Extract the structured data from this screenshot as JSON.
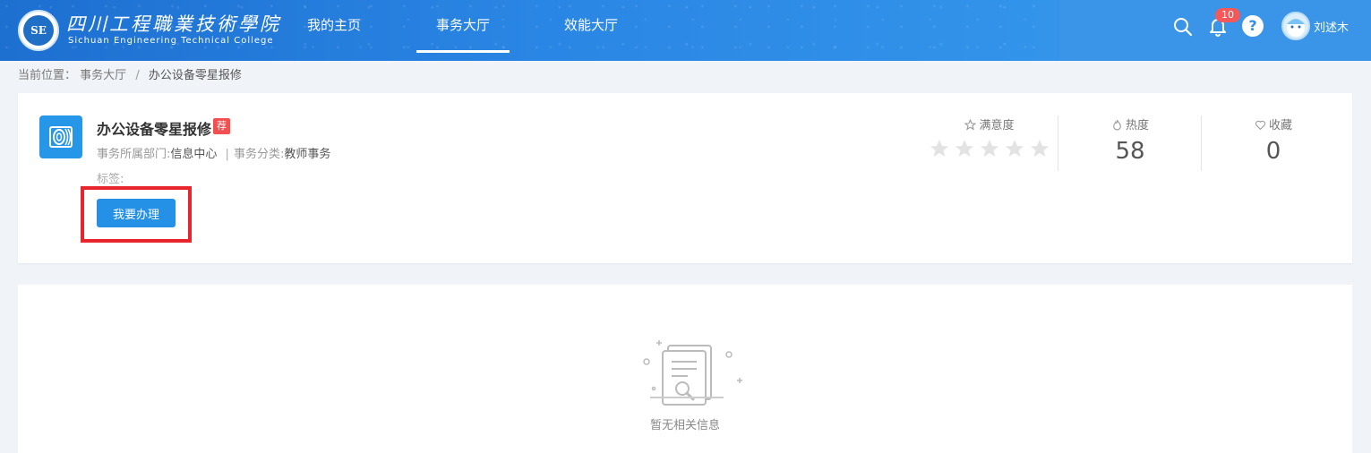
{
  "header": {
    "logo_badge": "SE",
    "logo_cn": "四川工程職業技術學院",
    "logo_en": "Sichuan Engineering Technical College",
    "nav": [
      {
        "label": "我的主页",
        "active": false
      },
      {
        "label": "事务大厅",
        "active": true
      },
      {
        "label": "效能大厅",
        "active": false
      }
    ],
    "notification_count": "10",
    "help_glyph": "?",
    "username": "刘述木"
  },
  "breadcrumb": {
    "prefix": "当前位置：",
    "items": [
      "事务大厅",
      "办公设备零星报修"
    ],
    "separator": "/"
  },
  "service": {
    "title": "办公设备零星报修",
    "recommend_badge": "荐",
    "dept_label": "事务所属部门:",
    "dept_value": "信息中心",
    "category_label": "事务分类:",
    "category_value": "教师事务",
    "meta_separator": "|",
    "tags_label": "标签:",
    "apply_button": "我要办理"
  },
  "stats": {
    "satisfaction_label": "满意度",
    "satisfaction_stars": 0,
    "satisfaction_max": 5,
    "heat_label": "热度",
    "heat_value": "58",
    "favorite_label": "收藏",
    "favorite_value": "0"
  },
  "empty": {
    "message": "暂无相关信息"
  },
  "colors": {
    "primary": "#2591e6",
    "highlight": "#e8252d",
    "badge": "#f25050"
  }
}
